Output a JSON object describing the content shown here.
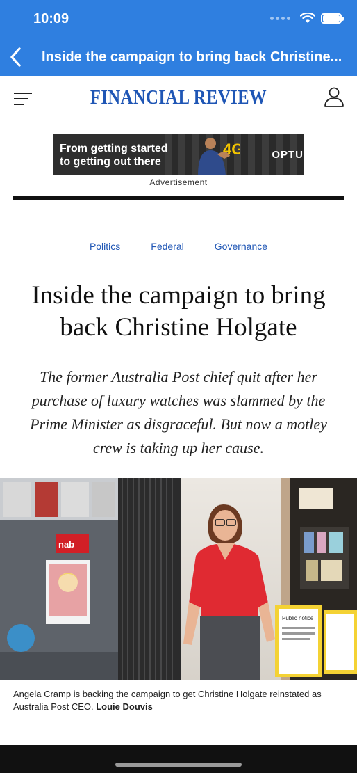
{
  "status_bar": {
    "time": "10:09"
  },
  "nav": {
    "title": "Inside the campaign to bring back Christine...",
    "back_icon": "chevron-left-icon"
  },
  "masthead": {
    "logo": "FINANCIAL REVIEW",
    "menu_icon": "hamburger-icon",
    "account_icon": "user-icon"
  },
  "advertisement": {
    "line1": "From getting started",
    "line2": "to getting out there",
    "brand": "OPTU",
    "label": "Advertisement"
  },
  "article": {
    "tags": [
      "Politics",
      "Federal",
      "Governance"
    ],
    "headline_line1": "Inside the campaign to bring",
    "headline_line2": "back Christine Holgate",
    "standfirst": "The former Australia Post chief quit after her purchase of luxury watches was slammed by the Prime Minister as disgraceful. But now a motley crew is taking up her cause.",
    "caption_text": "Angela Cramp is backing the campaign to get Christine Holgate reinstated as Australia Post CEO. ",
    "caption_credit": "Louie Douvis",
    "photo_signs": {
      "brand": "nab",
      "notice": "Public notice"
    }
  },
  "colors": {
    "accent": "#2f7fe0",
    "link": "#1f56b5",
    "shirt": "#e02a32"
  }
}
